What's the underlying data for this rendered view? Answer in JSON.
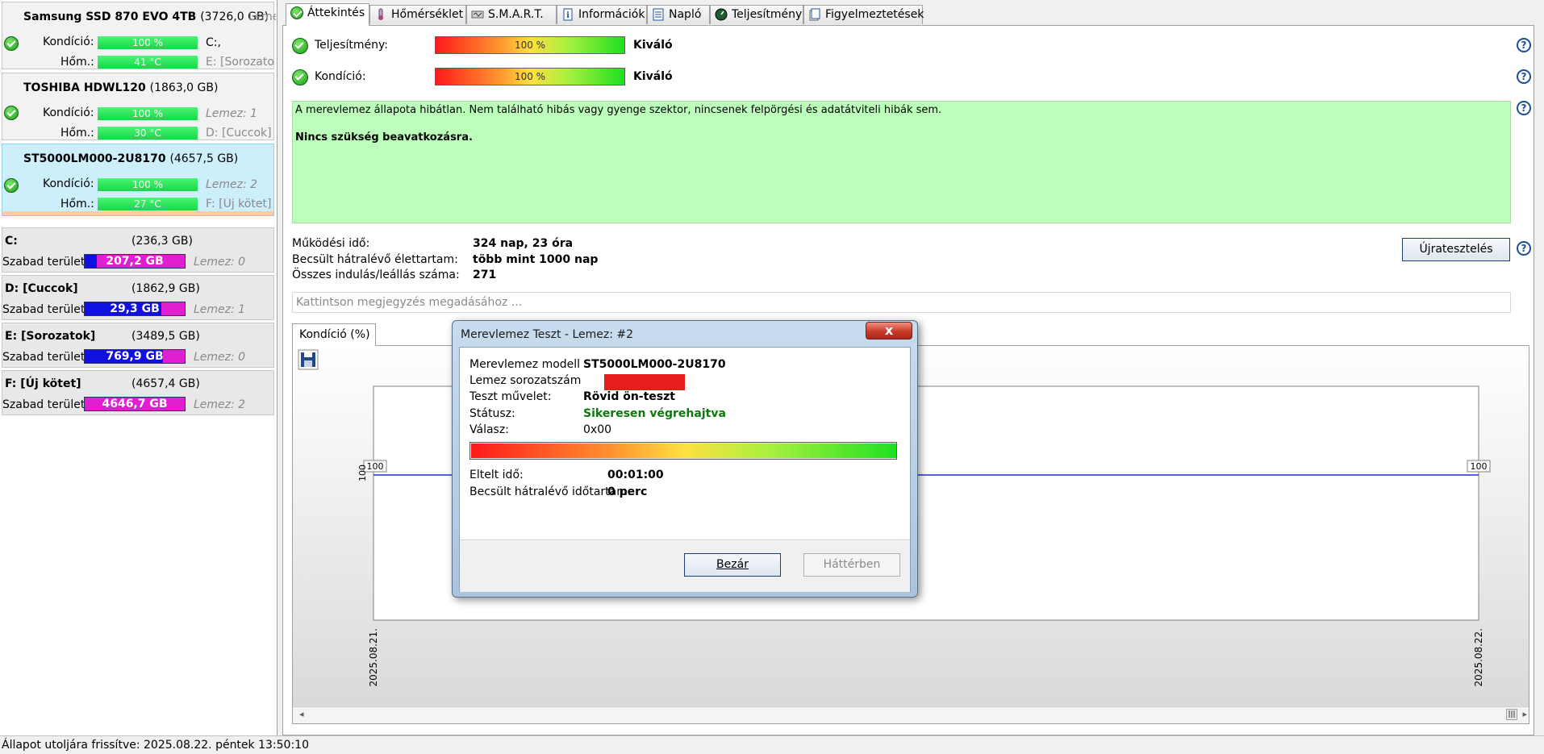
{
  "left_panel": {
    "disks": [
      {
        "name": "Samsung SSD 870 EVO 4TB",
        "size": "(3726,0 GB)",
        "condition_label": "Kondíció:",
        "condition": "100 %",
        "temp_label": "Hőm.:",
        "temp": "41 °C",
        "side1": "C:,",
        "side2": "E: [Sorozatok",
        "side1_extra": "Lemez"
      },
      {
        "name": "TOSHIBA HDWL120",
        "size": "(1863,0 GB)",
        "condition_label": "Kondíció:",
        "condition": "100 %",
        "temp_label": "Hőm.:",
        "temp": "30 °C",
        "side1": "Lemez: 1",
        "side2": "D: [Cuccok]"
      },
      {
        "name": "ST5000LM000-2U8170",
        "size": "(4657,5 GB)",
        "condition_label": "Kondíció:",
        "condition": "100 %",
        "temp_label": "Hőm.:",
        "temp": "27 °C",
        "side1": "Lemez: 2",
        "side2": "F: [Új kötet]"
      }
    ],
    "volumes": [
      {
        "name": "C:",
        "size": "(236,3 GB)",
        "free_label": "Szabad terület",
        "free": "207,2 GB",
        "free_fraction": 0.12,
        "disk": "Lemez: 0"
      },
      {
        "name": "D: [Cuccok]",
        "size": "(1862,9 GB)",
        "free_label": "Szabad terület",
        "free": "29,3 GB",
        "free_fraction": 0.77,
        "disk": "Lemez: 1"
      },
      {
        "name": "E: [Sorozatok]",
        "size": "(3489,5 GB)",
        "free_label": "Szabad terület",
        "free": "769,9 GB",
        "free_fraction": 0.78,
        "disk": "Lemez: 0"
      },
      {
        "name": "F: [Új kötet]",
        "size": "(4657,4 GB)",
        "free_label": "Szabad terület",
        "free": "4646,7 GB",
        "free_fraction": 0.0,
        "disk": "Lemez: 2"
      }
    ]
  },
  "tabs": [
    {
      "label": "Áttekintés",
      "icon": "check-icon"
    },
    {
      "label": "Hőmérséklet",
      "icon": "thermometer-icon"
    },
    {
      "label": "S.M.A.R.T.",
      "icon": "smart-icon"
    },
    {
      "label": "Információk",
      "icon": "info-icon"
    },
    {
      "label": "Napló",
      "icon": "log-icon"
    },
    {
      "label": "Teljesítmény",
      "icon": "gauge-icon"
    },
    {
      "label": "Figyelmeztetések",
      "icon": "warning-icon"
    }
  ],
  "overview": {
    "performance_label": "Teljesítmény:",
    "performance_value": "100 %",
    "performance_rating": "Kiváló",
    "condition_label": "Kondíció:",
    "condition_value": "100 %",
    "condition_rating": "Kiváló",
    "message": "A merevlemez állapota hibátlan. Nem található hibás vagy gyenge szektor, nincsenek felpörgési és adatátviteli hibák sem.",
    "advice": "Nincs szükség beavatkozásra.",
    "uptime_label": "Működési idő:",
    "uptime_value": "324 nap, 23 óra",
    "remaining_label": "Becsült hátralévő élettartam:",
    "remaining_value": "több mint 1000 nap",
    "starts_label": "Összes indulás/leállás száma:",
    "starts_value": "271",
    "retest_button": "Újratesztelés",
    "note_placeholder": "Kattintson megjegyzés megadásához ..."
  },
  "chart_tab": "Kondíció  (%)",
  "chart_data": {
    "type": "line",
    "x": [
      "2025.08.21.",
      "2025.08.22."
    ],
    "series": [
      {
        "values": [
          100,
          100
        ]
      }
    ],
    "ylim": [
      0,
      100
    ],
    "ylabel_visible": "100",
    "y_label_tick": "100",
    "x_ticks": [
      "2025.08.21.",
      "2025.08.22."
    ]
  },
  "dialog": {
    "title": "Merevlemez Teszt - Lemez: #2",
    "close": "x",
    "model_label": "Merevlemez modell",
    "model_value": "ST5000LM000-2U8170",
    "serial_label": "Lemez sorozatszám",
    "op_label": "Teszt művelet:",
    "op_value": "Rövid ön-teszt",
    "status_label": "Státusz:",
    "status_value": "Sikeresen végrehajtva",
    "response_label": "Válasz:",
    "response_value": "0x00",
    "elapsed_label": "Eltelt idő:",
    "elapsed_value": "00:01:00",
    "remaining_label": "Becsült hátralévő időtartam:",
    "remaining_value": "0 perc",
    "progress": 1.0,
    "close_button": "Bezár",
    "background_button": "Háttérben"
  },
  "statusbar": "Állapot utoljára frissítve: 2025.08.22. péntek 13:50:10",
  "colors": {
    "green_box": "#bbffbb",
    "status_ok": "#0a7a0a",
    "line": "#1a2fd0"
  }
}
